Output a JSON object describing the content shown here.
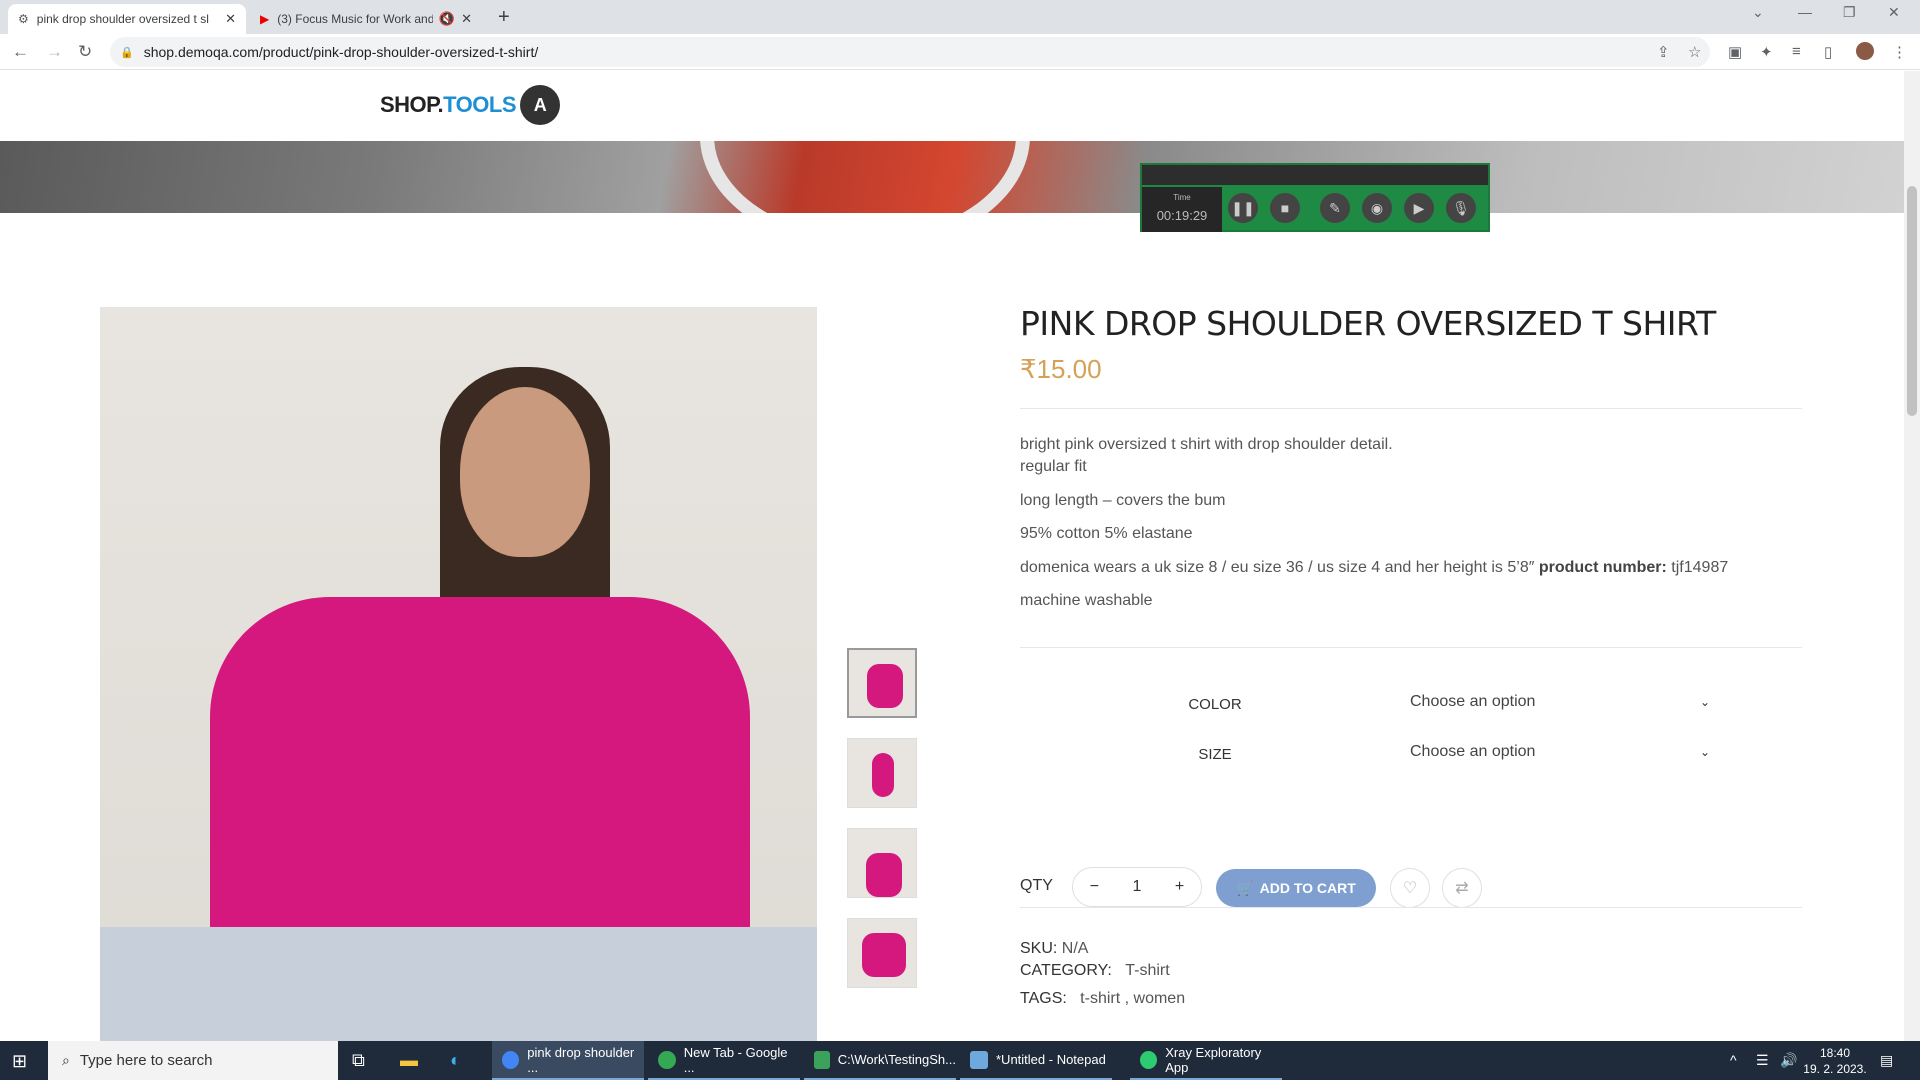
{
  "browser": {
    "tabs": [
      {
        "title": "pink drop shoulder oversized t sl",
        "active": true
      },
      {
        "title": "(3) Focus Music for Work and",
        "active": false
      }
    ],
    "url": "shop.demoqa.com/product/pink-drop-shoulder-oversized-t-shirt/"
  },
  "site": {
    "logo_shop": "SHOP.",
    "logo_tools": "TOOLS"
  },
  "recorder": {
    "time_label": "Time",
    "time_value": "00:19:29"
  },
  "product": {
    "title": "PINK DROP SHOULDER OVERSIZED T SHIRT",
    "price": "₹15.00",
    "desc_line1": "bright pink oversized t shirt with drop shoulder detail.",
    "desc_line2": "regular fit",
    "desc_line3": "long length – covers the bum",
    "desc_line4": "95% cotton 5% elastane",
    "desc_line5_text": "domenica wears a uk size 8 / eu size 36 / us size 4 and her height is 5’8″",
    "desc_line5_bold": "product number:",
    "desc_line5_value": "tjf14987",
    "desc_line6": "machine washable",
    "color_label": "COLOR",
    "color_value": "Choose an option",
    "size_label": "SIZE",
    "size_value": "Choose an option",
    "qty_label": "QTY",
    "qty_value": "1",
    "qty_minus": "−",
    "qty_plus": "+",
    "add_to_cart": "ADD TO CART",
    "sku_label": "SKU:",
    "sku_value": "N/A",
    "category_label": "CATEGORY:",
    "category_value": "T-shirt",
    "tags_label": "TAGS:",
    "tags_value": "t-shirt , women"
  },
  "taskbar": {
    "search_placeholder": "Type here to search",
    "apps": [
      {
        "label": "pink drop shoulder ...",
        "color": "#4285f4"
      },
      {
        "label": "New Tab - Google ...",
        "color": "#34a853"
      },
      {
        "label": "C:\\Work\\TestingSh...",
        "color": "#3ca15a"
      },
      {
        "label": "*Untitled - Notepad",
        "color": "#6fa8dc"
      },
      {
        "label": "Xray Exploratory App",
        "color": "#2ecc71"
      }
    ],
    "time": "18:40",
    "date": "19. 2. 2023."
  }
}
